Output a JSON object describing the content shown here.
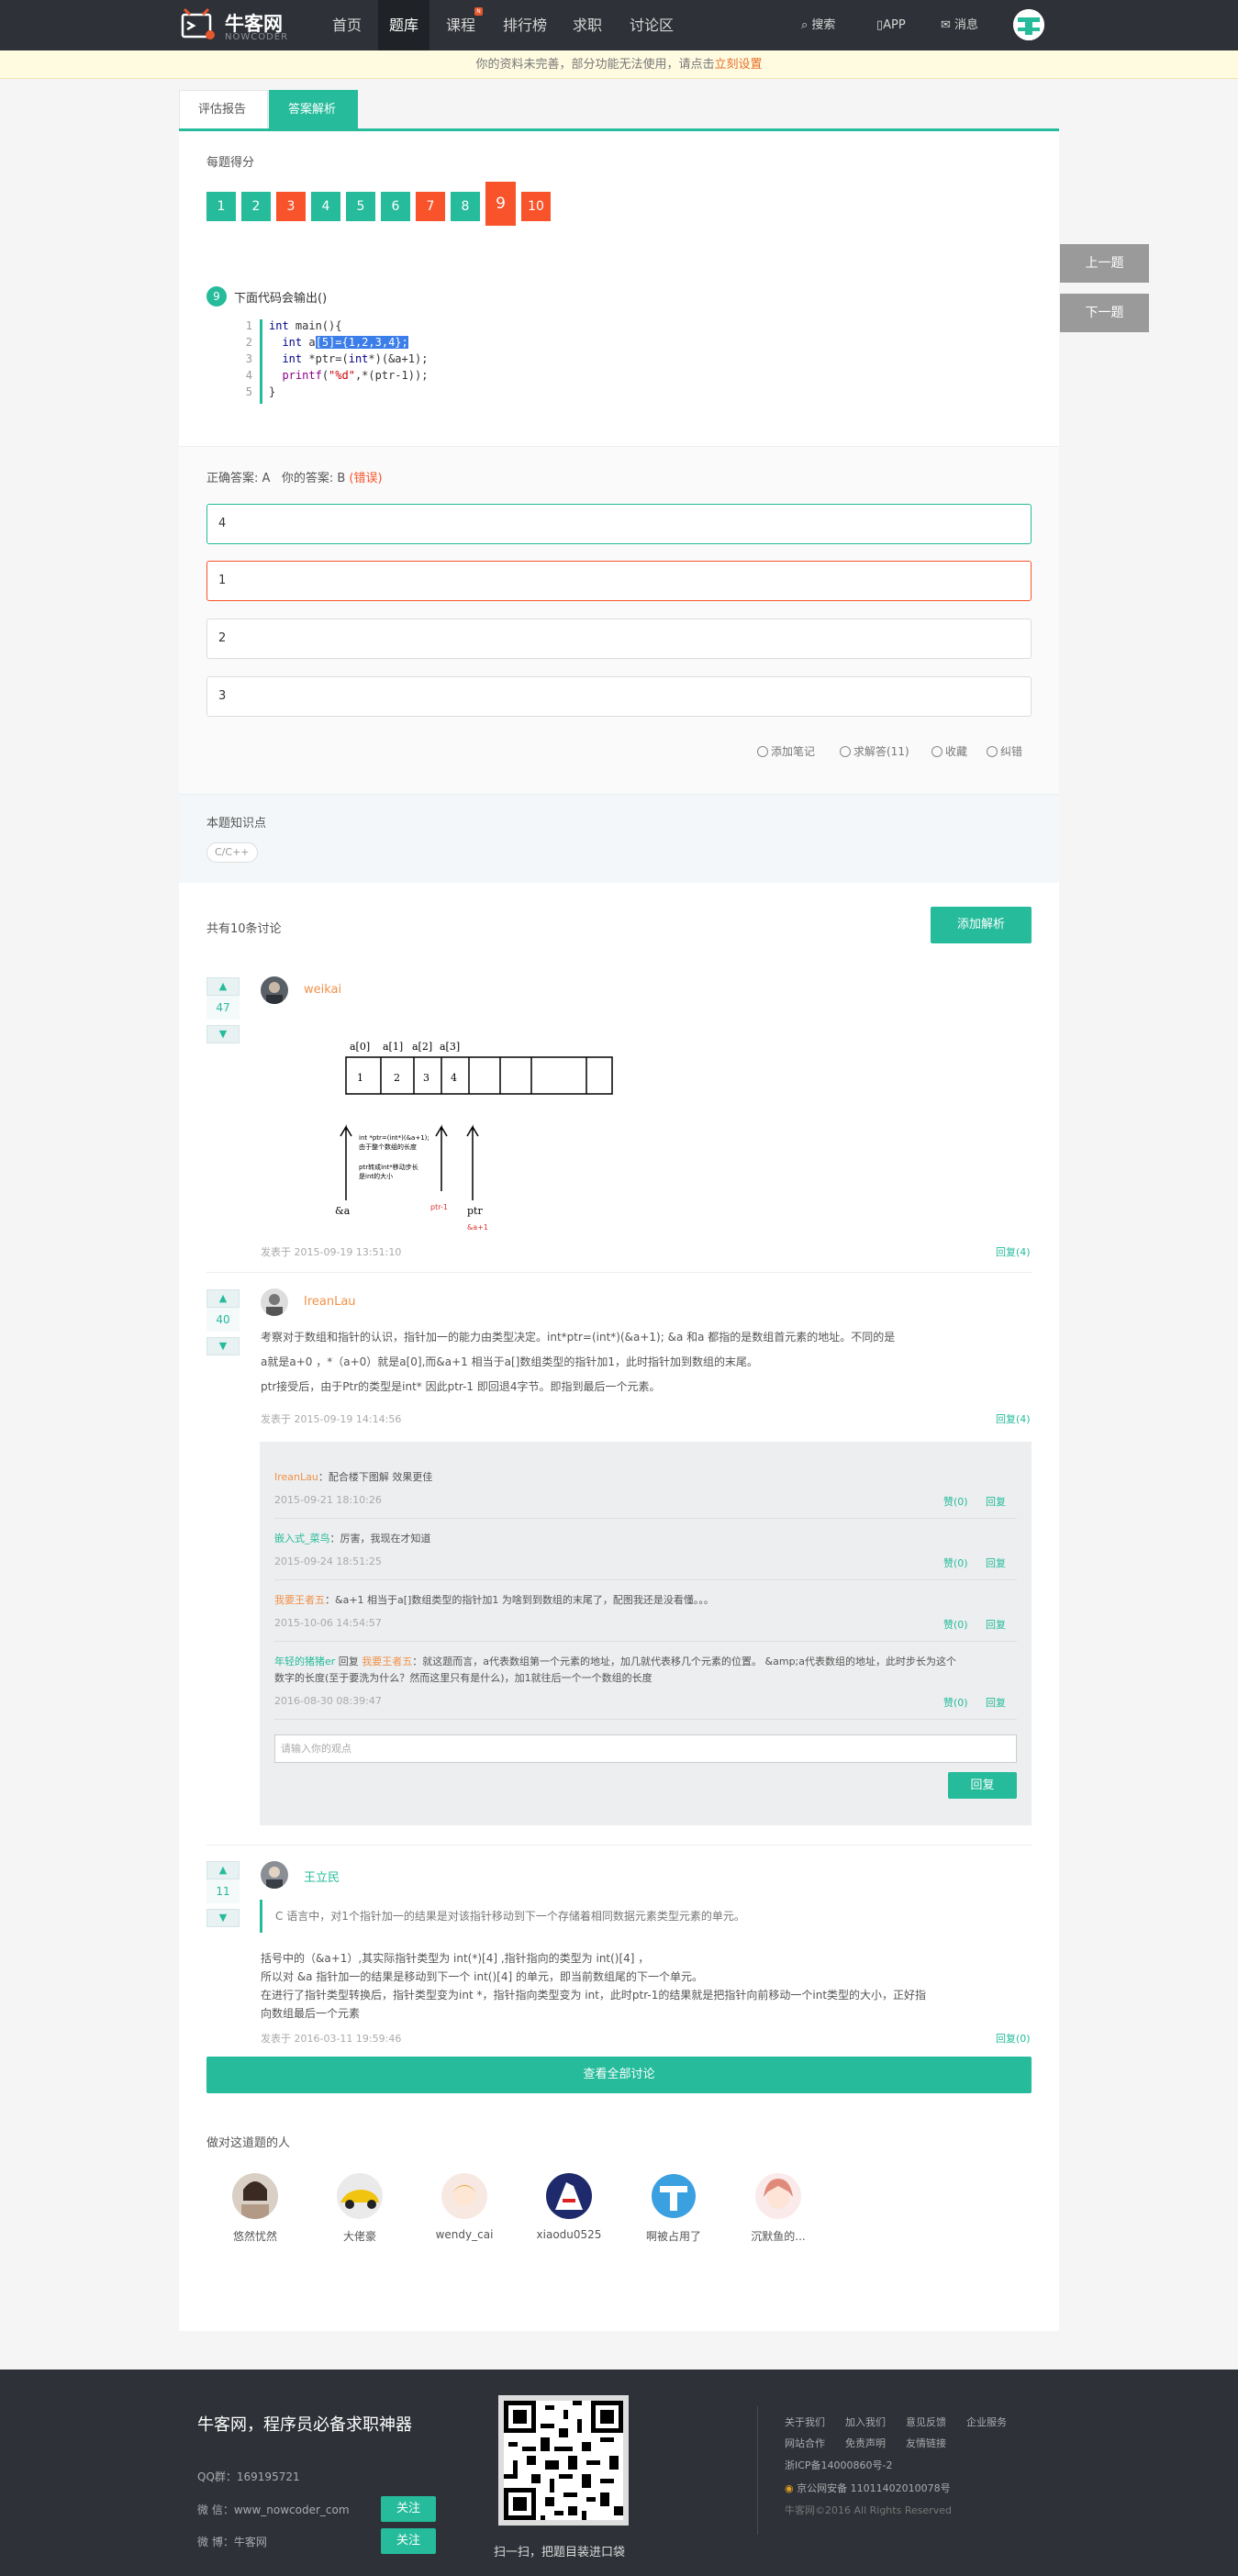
{
  "nav": {
    "logo_cn": "牛客网",
    "logo_en": "NOWCODER",
    "items": [
      "首页",
      "题库",
      "课程",
      "排行榜",
      "求职",
      "讨论区"
    ],
    "badge": "N",
    "search": "搜索",
    "app": "APP",
    "message": "消息"
  },
  "notice": {
    "text": "你的资料未完善，部分功能无法使用，请点击",
    "link": "立刻设置"
  },
  "tabs": [
    "评估报告",
    "答案解析"
  ],
  "score": {
    "label": "每题得分",
    "items": [
      {
        "n": "1",
        "status": "correct"
      },
      {
        "n": "2",
        "status": "correct"
      },
      {
        "n": "3",
        "status": "wrong"
      },
      {
        "n": "4",
        "status": "correct"
      },
      {
        "n": "5",
        "status": "correct"
      },
      {
        "n": "6",
        "status": "correct"
      },
      {
        "n": "7",
        "status": "wrong"
      },
      {
        "n": "8",
        "status": "correct"
      },
      {
        "n": "9",
        "status": "wrong"
      },
      {
        "n": "10",
        "status": "wrong"
      }
    ],
    "current": "9"
  },
  "question": {
    "num": "9",
    "title": "下面代码会输出()",
    "code_lines": [
      "1",
      "2",
      "3",
      "4",
      "5"
    ]
  },
  "answer": {
    "correct_label": "正确答案: A",
    "yours_label": "你的答案: B",
    "wrong_tag": "(错误)",
    "options": [
      "4",
      "1",
      "2",
      "3"
    ]
  },
  "actions": {
    "note": "添加笔记",
    "ask": "求解答(11)",
    "fav": "收藏",
    "fix": "纠错"
  },
  "knowledge": {
    "label": "本题知识点",
    "tag": "C/C++"
  },
  "discussion": {
    "count": "共有10条讨论",
    "add_btn": "添加解析",
    "posts": [
      {
        "votes": "47",
        "user": "weikai",
        "time": "发表于 2015-09-19 13:51:10",
        "reply": "回复(4)"
      },
      {
        "votes": "40",
        "user": "IreanLau",
        "time": "发表于 2015-09-19 14:14:56",
        "reply": "回复(4)",
        "lines": [
          "考察对于数组和指针的认识，指针加一的能力由类型决定。int*ptr=(int*)(&a+1);      &a 和a 都指的是数组首元素的地址。不同的是",
          "a就是a+0 ，*（a+0）就是a[0],而&a+1  相当于a[]数组类型的指针加1，此时指针加到数组的末尾。",
          "ptr接受后，由于Ptr的类型是int* 因此ptr-1  即回退4字节。即指到最后一个元素。"
        ]
      },
      {
        "votes": "11",
        "user": "王立民",
        "time": "发表于 2016-03-11 19:59:46",
        "reply": "回复(0)",
        "quote": "C 语言中，对1个指针加一的结果是对该指针移动到下一个存储着相同数据元素类型元素的单元。",
        "lines": [
          "括号中的（&a+1）,其实际指针类型为  int(*)[4]  ,指针指向的类型为    int()[4] ，",
          "所以对  &a  指针加一的结果是移动到下一个    int()[4]  的单元，即当前数组尾的下一个单元。",
          "在进行了指针类型转换后，指针类型变为int *，指针指向类型变为 int，此时ptr-1的结果就是把指针向前移动一个int类型的大小，正好指",
          "向数组最后一个元素"
        ]
      }
    ],
    "comments": [
      {
        "user": "IreanLau",
        "sep": "：",
        "text": "配合楼下图解 效果更佳",
        "time": "2015-09-21 18:10:26",
        "like": "赞(0)",
        "reply": "回复"
      },
      {
        "user": "嵌入式_菜鸟",
        "sep": "：",
        "text": "厉害，我现在才知道",
        "time": "2015-09-24 18:51:25",
        "like": "赞(0)",
        "reply": "回复"
      },
      {
        "user": "我要王者五",
        "sep": "：",
        "text": "&a+1 相当于a[]数组类型的指针加1 为啥到到数组的末尾了，配图我还是没看懂。。。",
        "time": "2015-10-06 14:54:57",
        "like": "赞(0)",
        "reply": "回复"
      },
      {
        "user": "年轻的猪猪er",
        "mid": "回复",
        "user2": "我要王者五",
        "sep": "：",
        "text": "就这题而言，a代表数组第一个元素的地址，加几就代表移几个元素的位置。 &amp;a代表数组的地址，此时步长为这个",
        "text2": "数字的长度(至于要洗为什么？然而这里只有是什么)，加1就往后一个一个数组的长度",
        "time": "2016-08-30 08:39:47",
        "like": "赞(0)",
        "reply": "回复"
      }
    ],
    "comment_placeholder": "请输入你的观点",
    "comment_btn": "回复",
    "view_all": "查看全部讨论"
  },
  "figure": {
    "labels": [
      "a[0]",
      "a[1]",
      "a[2]",
      "a[3]"
    ],
    "cells": [
      "1",
      "2",
      "3",
      "4"
    ],
    "p1": "&a",
    "p2": "ptr",
    "p3": "ptr-1",
    "p4": "&a+1",
    "note1a": "int *ptr=(int*)(&a+1);",
    "note1b": "由于整个数组的长度",
    "note2a": "ptr转成int*移动步长",
    "note2b": "是int的大小"
  },
  "people": {
    "label": "做对这道题的人",
    "list": [
      "悠然忧然",
      "大佬豪",
      "wendy_cai",
      "xiaodu0525",
      "啊被占用了",
      "沉默鱼的..."
    ]
  },
  "side": {
    "prev": "上一题",
    "next": "下一题"
  },
  "footer": {
    "slogan": "牛客网，程序员必备求职神器",
    "qq": "QQ群：169195721",
    "wechat": "微 信：www_nowcoder_com",
    "weibo": "微 博：牛客网",
    "follow": "关注",
    "qr_caption": "扫一扫，把题目装进口袋",
    "links": [
      "关于我们",
      "加入我们",
      "意见反馈",
      "企业服务",
      "网站合作",
      "免责声明",
      "友情链接"
    ],
    "icp": "浙ICP备14000860号-2",
    "police": "京公网安备 11011402010078号",
    "copyright": "牛客网©2016 All Rights Reserved"
  },
  "colors": {
    "accent": "#25bb9b",
    "wrong": "#f8532a",
    "nav": "#2e3137",
    "orange": "#f19149"
  }
}
